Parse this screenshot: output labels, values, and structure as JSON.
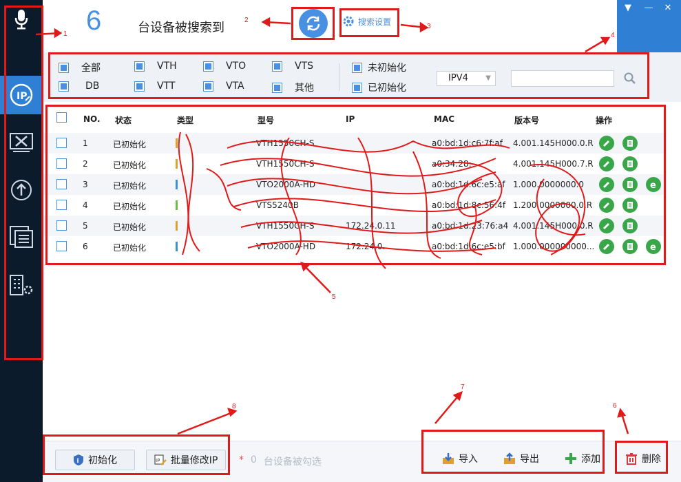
{
  "header": {
    "device_count": "6",
    "found_text": "台设备被搜索到",
    "search_settings_label": "搜索设置"
  },
  "window_controls": [
    "▼",
    "—",
    "✕"
  ],
  "filters": {
    "row1": [
      "全部",
      "VTH",
      "VTO",
      "VTS"
    ],
    "row2": [
      "DB",
      "VTT",
      "VTA",
      "其他"
    ],
    "status": [
      "未初始化",
      "已初始化"
    ],
    "ip_version": "IPV4",
    "search_value": ""
  },
  "table": {
    "columns": [
      "NO.",
      "状态",
      "类型",
      "型号",
      "IP",
      "MAC",
      "版本号",
      "操作"
    ],
    "rows": [
      {
        "no": "1",
        "status": "已初始化",
        "model": "VTH1550CH-S",
        "ip": "",
        "mac": "a0:bd:1d:c6:7f:af",
        "version": "4.001.145H000.0.R",
        "actions": 2,
        "tag": "#e0a030"
      },
      {
        "no": "2",
        "status": "已初始化",
        "model": "VTH1550CH-S",
        "ip": "",
        "mac": "a0:34:28:",
        "version": "4.001.145H000.7.R",
        "actions": 2,
        "tag": "#e0a030"
      },
      {
        "no": "3",
        "status": "已初始化",
        "model": "VTO2000A-HD",
        "ip": "",
        "mac": "a0:bd:1d:6c:e5:af",
        "version": "1.000.0000000.0",
        "actions": 3,
        "tag": "#3a8fe0"
      },
      {
        "no": "4",
        "status": "已初始化",
        "model": "VTS5240B",
        "ip": "",
        "mac": "a0:bd:1d:8c:56:4f",
        "version": "1.200.0000000.0.R",
        "actions": 2,
        "tag": "#6abf40"
      },
      {
        "no": "5",
        "status": "已初始化",
        "model": "VTH1550CH-S",
        "ip": "172.24.0.11",
        "mac": "a0:bd:1d:23:76:a4",
        "version": "4.001.145H000.0.R",
        "actions": 2,
        "tag": "#e0a030"
      },
      {
        "no": "6",
        "status": "已初始化",
        "model": "VTO2000A-HD",
        "ip": "172.24.0.",
        "mac": "a0:bd:1d:6c:e5:bf",
        "version": "1.000.000000000...",
        "actions": 3,
        "tag": "#3a8fe0"
      }
    ]
  },
  "footer": {
    "init_label": "初始化",
    "batch_ip_label": "批量修改IP",
    "selected_count": "0",
    "selected_text": "台设备被勾选",
    "import_label": "导入",
    "export_label": "导出",
    "add_label": "添加",
    "delete_label": "删除"
  },
  "annotations": [
    "1",
    "2",
    "3",
    "4",
    "5",
    "6",
    "7",
    "8"
  ],
  "colors": {
    "accent": "#2f7fd4",
    "sidebar": "#0c1b2b",
    "annotation": "#e01a1a",
    "action_green": "#3aa64a"
  }
}
